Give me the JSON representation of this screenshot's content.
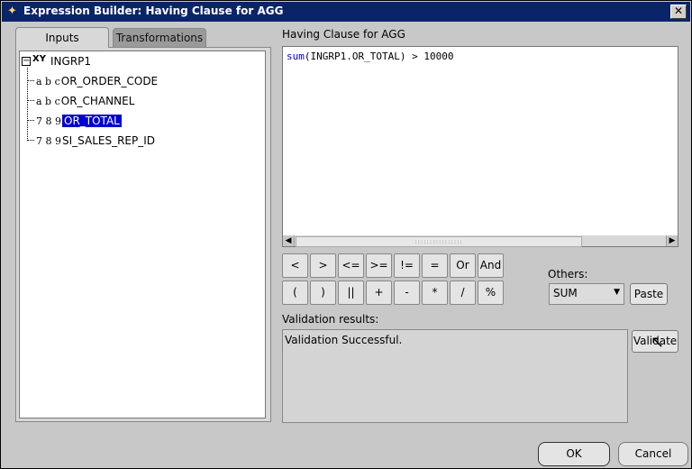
{
  "window": {
    "title": "Expression Builder: Having Clause for AGG",
    "close_glyph": "✕"
  },
  "tabs": [
    {
      "label": "Inputs"
    },
    {
      "label": "Transformations"
    }
  ],
  "tree": {
    "root": {
      "label": "INGRP1",
      "expander": "−",
      "icon_text": "XY"
    },
    "items": [
      {
        "type": "abc",
        "type_display": "a b c",
        "label": "OR_ORDER_CODE"
      },
      {
        "type": "abc",
        "type_display": "a b c",
        "label": "OR_CHANNEL"
      },
      {
        "type": "num",
        "type_display": "7 8 9",
        "label": "OR_TOTAL",
        "selected": true
      },
      {
        "type": "num",
        "type_display": "7 8 9",
        "label": "SI_SALES_REP_ID"
      }
    ]
  },
  "editor": {
    "label": "Having Clause for AGG",
    "code_keyword": "sum",
    "code_rest": "(INGRP1.OR_TOTAL) > 10000"
  },
  "operators": {
    "row1": [
      "<",
      ">",
      "<=",
      ">=",
      "!=",
      "=",
      "Or",
      "And"
    ],
    "row2": [
      "(",
      ")",
      "||",
      "+",
      "-",
      "*",
      "/",
      "%"
    ]
  },
  "others": {
    "label": "Others:",
    "value": "SUM",
    "paste_label": "Paste"
  },
  "validation": {
    "label": "Validation results:",
    "result": "Validation Successful.",
    "validate_label": "Validate"
  },
  "footer": {
    "ok_label": "OK",
    "cancel_label": "Cancel"
  }
}
